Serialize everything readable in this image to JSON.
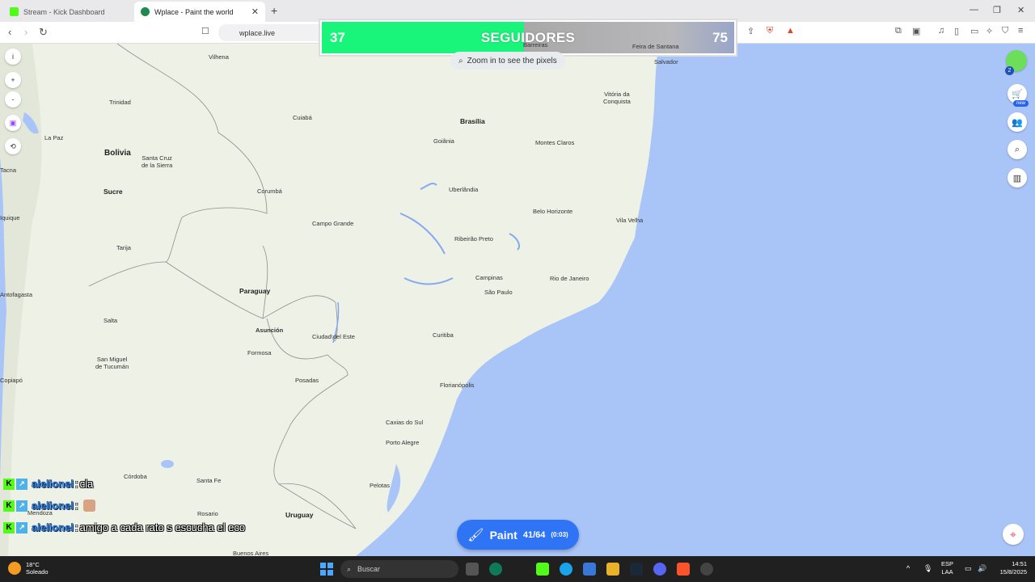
{
  "browser": {
    "tabs": [
      {
        "title": "Stream - Kick Dashboard",
        "favicon_color": "#53fc18"
      },
      {
        "title": "Wplace - Paint the world",
        "favicon_color": "#1f8a4c"
      }
    ],
    "new_tab_symbol": "+",
    "url": "wplace.live",
    "window_controls": [
      "—",
      "❐",
      "✕"
    ]
  },
  "follower_goal": {
    "current": "37",
    "label": "SEGUIDORES",
    "goal": "75",
    "progress_fraction": 0.4933,
    "fill_color": "#19f57a"
  },
  "map": {
    "zoom_hint": "Zoom in to see the pixels",
    "ocean_color": "#a9c4f7",
    "land_color": "#eef1e6",
    "places": {
      "vilhena": "Vilhena",
      "trinidad": "Trinidad",
      "la_paz": "La Paz",
      "bolivia": "Bolivia",
      "santa_cruz": "Santa Cruz\nde la Sierra",
      "sucre": "Sucre",
      "tacna": "Tacna",
      "iquique": "Iquique",
      "tarija": "Tarija",
      "antofagasta": "Antofagasta",
      "salta": "Salta",
      "tucuman": "San Miguel\nde Tucumán",
      "copiapo": "Copiapó",
      "cordoba": "Córdoba",
      "mendoza": "Mendoza",
      "santa_fe": "Santa Fe",
      "rosario": "Rosario",
      "buenos_aires": "Buenos Aires",
      "uruguay": "Uruguay",
      "cuiaba": "Cuiabá",
      "corumba": "Corumbá",
      "campo_grande": "Campo Grande",
      "paraguay": "Paraguay",
      "asuncion": "Asunción",
      "formosa": "Formosa",
      "ciudad_del_este": "Ciudad del Este",
      "posadas": "Posadas",
      "brasilia": "Brasília",
      "goiania": "Goiânia",
      "uberlandia": "Uberlândia",
      "ribeirao_preto": "Ribeirão Preto",
      "campinas": "Campinas",
      "sao_paulo": "São Paulo",
      "rio": "Rio de Janeiro",
      "belo_horizonte": "Belo Horizonte",
      "montes_claros": "Montes Claros",
      "vitoria_conquista": "Vitória da\nConquista",
      "vila_velha": "Vila Velha",
      "curitiba": "Curitiba",
      "florianopolis": "Florianópolis",
      "caxias": "Caxias do Sul",
      "porto_alegre": "Porto Alegre",
      "pelotas": "Pelotas",
      "feira": "Feira de Santana",
      "salvador": "Salvador",
      "barreiras": "Barreiras"
    }
  },
  "left_controls": [
    "i",
    "+",
    "-",
    "▣",
    "⟲"
  ],
  "right_controls": {
    "user_count": "2",
    "new_badge": "new"
  },
  "paint_button": {
    "label": "Paint",
    "count": "41/64",
    "timer": "(0:03)"
  },
  "chat": [
    {
      "user": "alelionel",
      "sep": ":",
      "message": "cla",
      "emote": false
    },
    {
      "user": "alelionel",
      "sep": ":",
      "message": "",
      "emote": true
    },
    {
      "user": "alelionel",
      "sep": ":",
      "message": "amigo a cada rato s escucha el eco",
      "emote": false
    }
  ],
  "taskbar": {
    "temperature": "18°C",
    "condition": "Soleado",
    "search_placeholder": "Buscar",
    "lang_top": "ESP",
    "lang_bottom": "LAA",
    "time": "14:51",
    "date": "15/8/2025"
  }
}
